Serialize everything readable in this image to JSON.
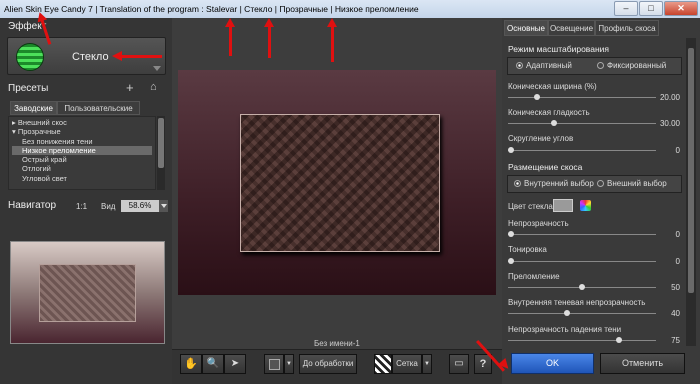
{
  "window": {
    "title": "Alien Skin Eye Candy 7 | Translation of the program : Stalevar | Стекло | Прозрачные | Низкое преломление"
  },
  "left": {
    "effect_header": "Эффект",
    "effect_name": "Стекло",
    "presets_header": "Пресеты",
    "add_glyph": "+",
    "home_glyph": "⌂",
    "tabs": [
      "Заводские",
      "Пользовательские"
    ],
    "tree": [
      "▸ Внешний скос",
      "▾ Прозрачные",
      "Без понижения тени",
      "Низкое преломление",
      "Острый край",
      "Отлогий",
      "Угловой свет"
    ],
    "navigator_header": "Навигатор",
    "zoom_1to1": "1:1",
    "view_label": "Вид",
    "zoom_value": "58.6%"
  },
  "center": {
    "status": "Без имени-1",
    "before_btn": "До обработки",
    "grid_label": "Сетка",
    "help": "?"
  },
  "right": {
    "tabs": [
      "Основные",
      "Освещение",
      "Профиль скоса"
    ],
    "scale_mode": "Режим масштабирования",
    "adaptive": "Адаптивный",
    "fixed": "Фиксированный",
    "bevel_width": "Коническая ширина (%)",
    "bevel_width_val": "20.00",
    "bevel_smooth": "Коническая гладкость",
    "bevel_smooth_val": "30.00",
    "corner": "Скругление углов",
    "corner_val": "0",
    "placement": "Размещение скоса",
    "inner": "Внутренний выбор",
    "outer": "Внешний выбор",
    "glass_color": "Цвет стекла",
    "opacity": "Непрозрачность",
    "opacity_val": "0",
    "tint": "Тонировка",
    "tint_val": "0",
    "refraction": "Преломление",
    "refraction_val": "50",
    "inner_shadow": "Внутренняя теневая непрозрачность",
    "inner_shadow_val": "40",
    "drop_shadow": "Непрозрачность падения тени",
    "drop_shadow_val": "75",
    "ok": "OK",
    "cancel": "Отменить"
  },
  "colors": {
    "arrow": "#e01010",
    "ok_blue": "#2a64c5",
    "glass_swatch": "#9a9a9a"
  }
}
